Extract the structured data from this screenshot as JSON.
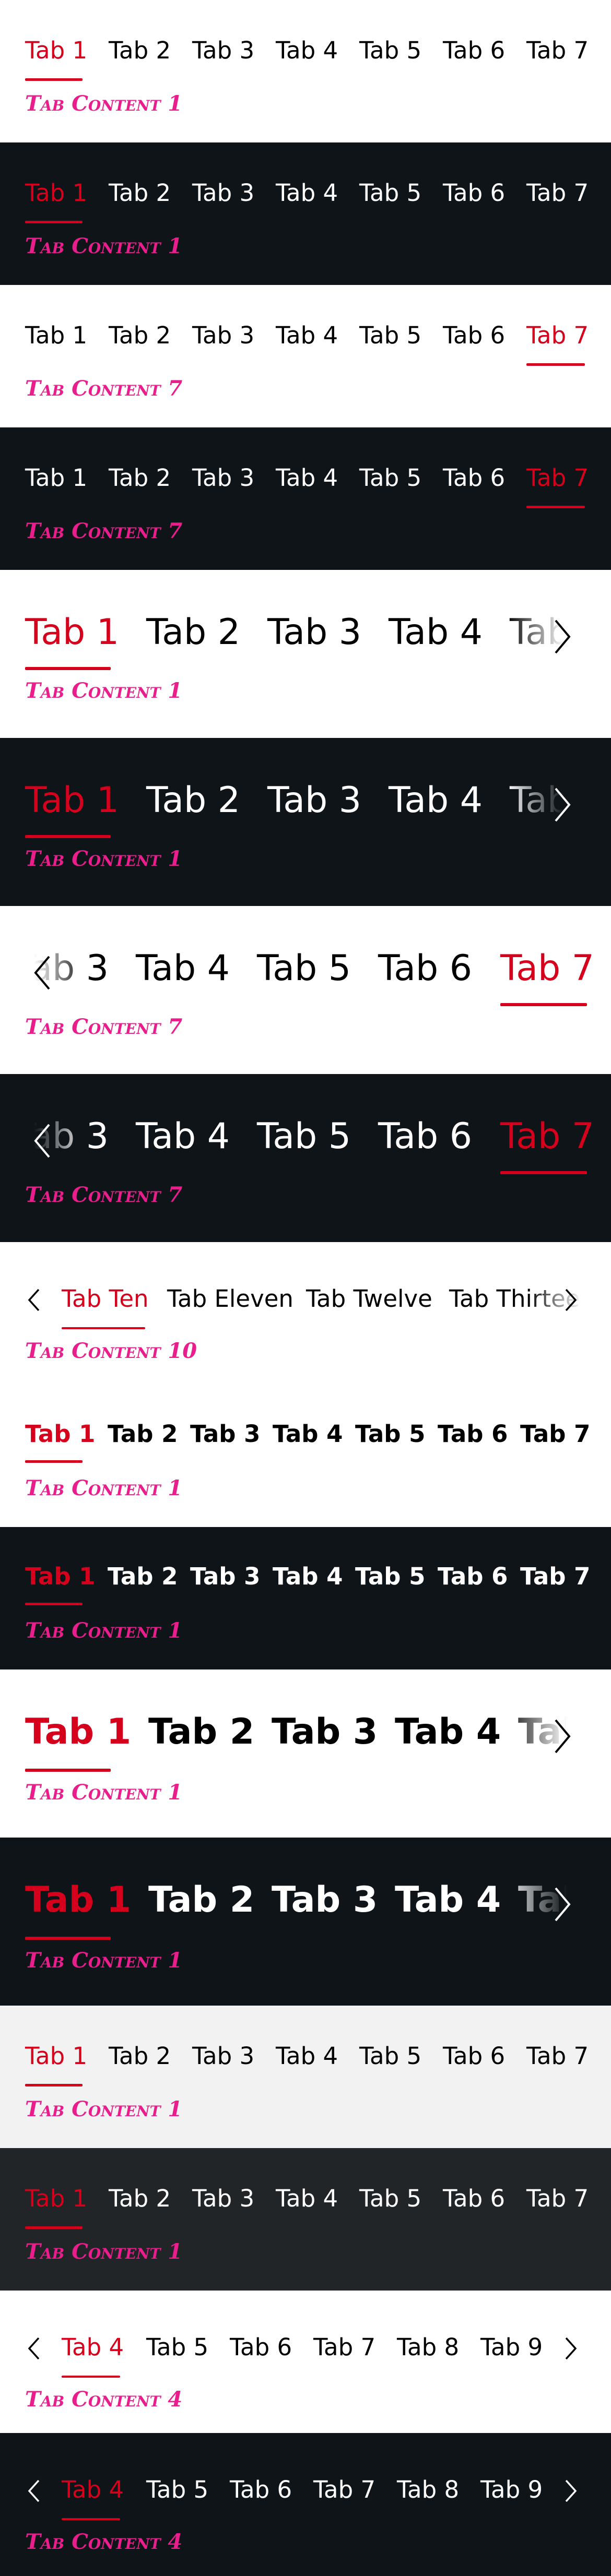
{
  "colors": {
    "accent": "#d5001c",
    "content_text": "#e91e8c",
    "dark_bg": "#0e1418",
    "light_grey_bg": "#f2f2f2",
    "dark_grey_bg": "#212528"
  },
  "tabs_basic": [
    "Tab 1",
    "Tab 2",
    "Tab 3",
    "Tab 4",
    "Tab 5",
    "Tab 6",
    "Tab 7"
  ],
  "tabs_ten": [
    "Tab Ten",
    "Tab Eleven",
    "Tab Twelve",
    "Tab Thirteen"
  ],
  "tabs_four_to_nine": [
    "Tab 4",
    "Tab 5",
    "Tab 6",
    "Tab 7",
    "Tab 8",
    "Tab 9"
  ],
  "content": {
    "tab1": "Tab Content 1",
    "tab7": "Tab Content 7",
    "tab10": "Tab Content 10",
    "tab4": "Tab Content 4"
  },
  "icons": {
    "prev": "chevron-left-icon",
    "next": "chevron-right-icon"
  }
}
